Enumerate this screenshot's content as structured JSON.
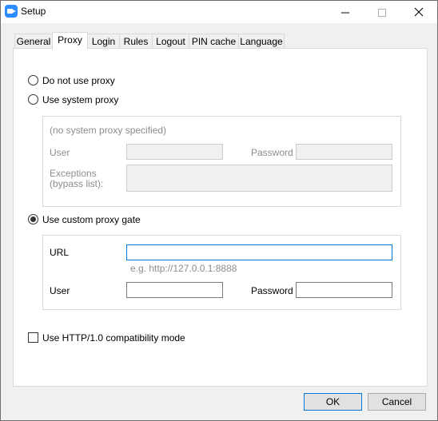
{
  "window": {
    "title": "Setup"
  },
  "tabs": [
    {
      "label": "General"
    },
    {
      "label": "Proxy"
    },
    {
      "label": "Login"
    },
    {
      "label": "Rules"
    },
    {
      "label": "Logout"
    },
    {
      "label": "PIN cache"
    },
    {
      "label": "Language"
    }
  ],
  "active_tab": "Proxy",
  "proxy": {
    "options": [
      {
        "label": "Do not use proxy",
        "selected": false
      },
      {
        "label": "Use system proxy",
        "selected": false
      },
      {
        "label": "Use custom proxy gate",
        "selected": true
      }
    ],
    "system": {
      "note": "(no system proxy specified)",
      "user_label": "User",
      "password_label": "Password",
      "exceptions_label_1": "Exceptions",
      "exceptions_label_2": "(bypass list):",
      "user_value": "",
      "password_value": "",
      "exceptions_value": ""
    },
    "custom": {
      "url_label": "URL",
      "url_value": "",
      "url_hint": "e.g. http://127.0.0.1:8888",
      "user_label": "User",
      "password_label": "Password",
      "user_value": "",
      "password_value": ""
    },
    "http10": {
      "label": "Use HTTP/1.0 compatibility mode",
      "checked": false
    }
  },
  "buttons": {
    "ok": "OK",
    "cancel": "Cancel"
  },
  "icons": {
    "minimize": "minimize-icon",
    "maximize": "maximize-icon",
    "close": "close-icon",
    "app": "app-icon"
  },
  "colors": {
    "accent": "#0078d7",
    "app_icon": "#2d8cff"
  }
}
